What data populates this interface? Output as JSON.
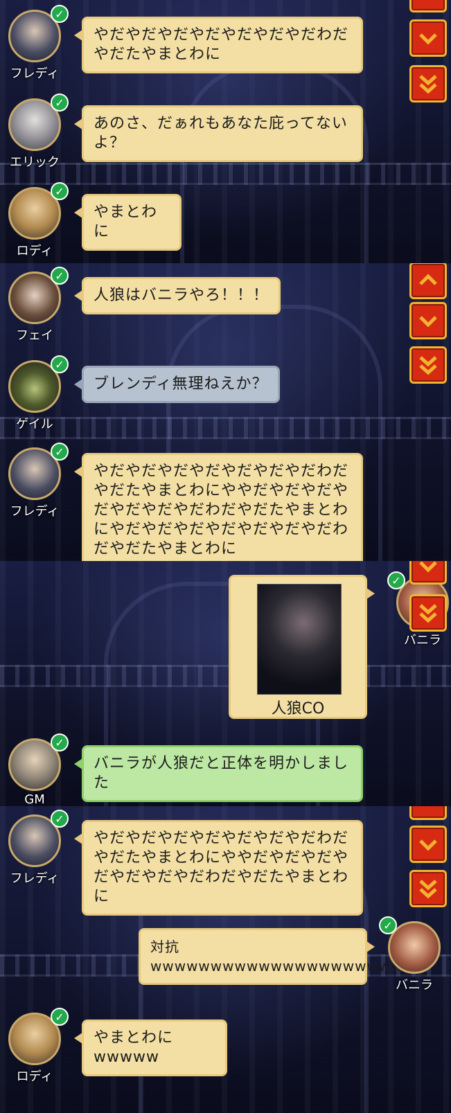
{
  "panels": [
    {
      "messages": [
        {
          "speaker": "フレディ",
          "text": "やだやだやだやだやだやだやだわだやだたやまとわに",
          "style": "yellow",
          "side": "left"
        },
        {
          "speaker": "エリック",
          "text": "あのさ、だぁれもあなた庇ってないよ？",
          "style": "yellow",
          "side": "left"
        },
        {
          "speaker": "ロディ",
          "text": "やまとわに",
          "style": "yellow",
          "side": "left"
        }
      ]
    },
    {
      "messages": [
        {
          "speaker": "フェイ",
          "text": "人狼はバニラやろ！！！",
          "style": "yellow",
          "side": "left"
        },
        {
          "speaker": "ゲイル",
          "text": "ブレンディ無理ねえか？",
          "style": "gray",
          "side": "left"
        },
        {
          "speaker": "フレディ",
          "text": "やだやだやだやだやだやだやだわだやだたやまとわにややだやだやだやだやだやだやだわだやだたやまとわにやだやだやだやだやだやだやだわだやだたやまとわに",
          "style": "yellow",
          "side": "left"
        }
      ]
    },
    {
      "messages": [
        {
          "speaker": "バニラ",
          "card_caption": "人狼CO",
          "style": "card",
          "side": "right"
        },
        {
          "speaker": "GM",
          "text": "バニラが人狼だと正体を明かしました",
          "style": "green",
          "side": "left"
        }
      ]
    },
    {
      "messages": [
        {
          "speaker": "フレディ",
          "text": "やだやだやだやだやだやだやだわだやだたやまとわにややだやだやだやだやだやだやだわだやだたやまとわに",
          "style": "yellow",
          "side": "left"
        },
        {
          "speaker": "バニラ",
          "text": "対抗wwwwwwwwwwwwwwwwwwwwww",
          "style": "yellow",
          "side": "right"
        },
        {
          "speaker": "ロディ",
          "text": "やまとわにwwwww",
          "style": "yellow",
          "side": "left"
        }
      ]
    }
  ],
  "colors": {
    "bubble_yellow": "#f3dfa3",
    "bubble_gray": "#b6c2cf",
    "bubble_green": "#bde8a4",
    "check_green": "#22a94a",
    "scroll_button_red": "#d72a12",
    "scroll_button_border": "#f2b330"
  },
  "scroll_buttons": [
    "scroll-up",
    "scroll-down",
    "scroll-to-bottom"
  ]
}
